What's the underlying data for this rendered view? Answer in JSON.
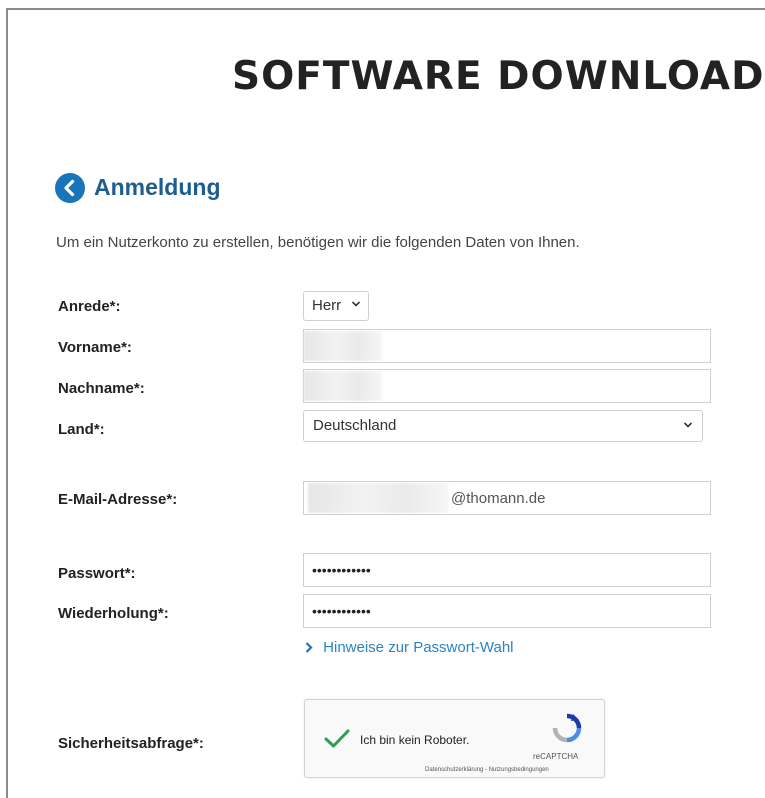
{
  "page_title": "SOFTWARE DOWNLOAD",
  "section": {
    "title": "Anmeldung",
    "back_icon": "chevron-left-circle-icon"
  },
  "intro": "Um ein Nutzerkonto zu erstellen, benötigen wir die folgenden Daten von Ihnen.",
  "form": {
    "salutation": {
      "label": "Anrede*:",
      "value": "Herr"
    },
    "first_name": {
      "label": "Vorname*:",
      "value": ""
    },
    "last_name": {
      "label": "Nachname*:",
      "value": ""
    },
    "country": {
      "label": "Land*:",
      "value": "Deutschland"
    },
    "email": {
      "label": "E-Mail-Adresse*:",
      "value_suffix": "@thomann.de"
    },
    "password": {
      "label": "Passwort*:",
      "masked": "••••••••••••"
    },
    "password_repeat": {
      "label": "Wiederholung*:",
      "masked": "••••••••••••"
    },
    "password_hint_link": "Hinweise zur Passwort-Wahl",
    "security": {
      "label": "Sicherheitsabfrage*:"
    }
  },
  "captcha": {
    "label": "Ich bin kein Roboter.",
    "brand": "reCAPTCHA",
    "links": "Datenschutzerklärung - Nutzungsbedingungen",
    "checked": true,
    "check_color": "#2e9e4f"
  },
  "colors": {
    "accent": "#1a75b8",
    "heading": "#1e5d8f",
    "link": "#2a83c6"
  }
}
